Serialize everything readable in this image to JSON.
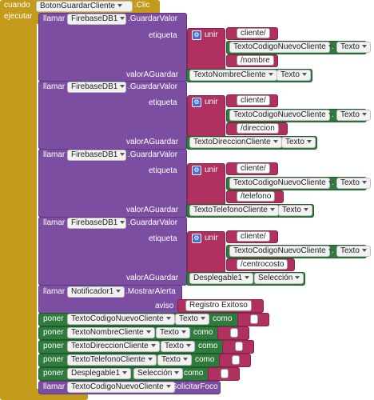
{
  "event": {
    "cuando": "cuando",
    "component": "BotonGuardarCliente",
    "event": ".Clic",
    "ejecutar": "ejecutar"
  },
  "labels": {
    "llamar": "llamar",
    "guardar": ".GuardarValor",
    "etiqueta": "etiqueta",
    "valorAGuardar": "valorAGuardar",
    "unir": "unir",
    "dot": ".",
    "texto": "Texto",
    "seleccion": "Selección",
    "poner": "poner",
    "como": "como",
    "aviso": "aviso",
    "mostrarAlerta": ".MostrarAlerta",
    "solicitarFoco": ".SolicitarFoco"
  },
  "db": "FirebaseDB1",
  "codigo": "TextoCodigoNuevoCliente",
  "calls": [
    {
      "p1": "cliente/",
      "p3": "/nombre",
      "value_comp": "TextoNombreCliente",
      "value_prop": "Texto"
    },
    {
      "p1": "cliente/",
      "p3": "/direccion",
      "value_comp": "TextoDireccionCliente",
      "value_prop": "Texto"
    },
    {
      "p1": "cliente/",
      "p3": "/telefono",
      "value_comp": "TextoTelefonoCliente",
      "value_prop": "Texto"
    },
    {
      "p1": "cliente/",
      "p3": "/centrocosto",
      "value_comp": "Desplegable1",
      "value_prop": "Selección"
    }
  ],
  "alert": {
    "component": "Notificador1",
    "message": "Registro Exitoso"
  },
  "sets": [
    {
      "component": "TextoCodigoNuevoCliente",
      "prop": "Texto"
    },
    {
      "component": "TextoNombreCliente",
      "prop": "Texto"
    },
    {
      "component": "TextoDireccionCliente",
      "prop": "Texto"
    },
    {
      "component": "TextoTelefonoCliente",
      "prop": "Texto"
    },
    {
      "component": "Desplegable1",
      "prop": "Selección"
    }
  ],
  "focus": {
    "component": "TextoCodigoNuevoCliente"
  },
  "colors": {
    "control": "#c49a1b",
    "component_call": "#7b4ea1",
    "text": "#b0305f",
    "component_set": "#2f7a3d",
    "gear": "#4d6bd6"
  }
}
